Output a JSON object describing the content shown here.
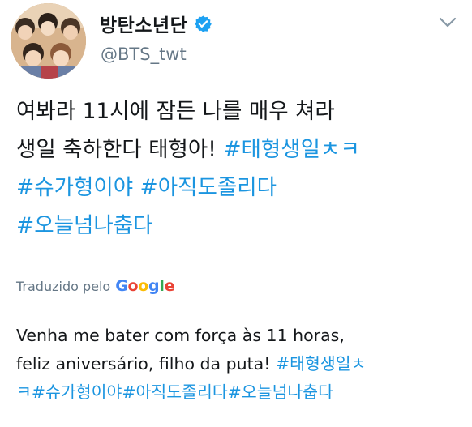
{
  "author": {
    "display_name": "방탄소년단",
    "handle": "@BTS_twt",
    "verified": true,
    "verified_icon": "verified-badge-icon",
    "avatar_icon": "group-photo-avatar"
  },
  "menu": {
    "icon": "chevron-down-icon"
  },
  "tweet": {
    "line1": "여봐라 11시에 잠든 나를 매우 쳐라",
    "line2_text": "생일 축하한다 태형아! ",
    "line2_hashtag": "#태형생일ㅊㅋ",
    "line3_hashtag1": "#슈가형이야",
    "line3_space": " ",
    "line3_hashtag2": "#아직도졸리다",
    "line4_hashtag": "#오늘넘나춥다"
  },
  "translation": {
    "prefix": "Traduzido pelo",
    "google_letters": [
      "G",
      "o",
      "o",
      "g",
      "l",
      "e"
    ],
    "google_colors": [
      "#4285f4",
      "#ea4335",
      "#fbbc05",
      "#4285f4",
      "#34a853",
      "#ea4335"
    ],
    "line1": "Venha me bater com força às 11 horas,",
    "line2_text": "feliz aniversário, filho da puta! ",
    "line2_hashtag": "#태형생일ㅊ",
    "line3_hashtag": "ㅋ#슈가형이야#아직도졸리다#오늘넘나춥다"
  },
  "colors": {
    "hashtag": "#1b95e0",
    "text": "#14171a",
    "secondary": "#657786",
    "verified": "#1da1f2"
  }
}
